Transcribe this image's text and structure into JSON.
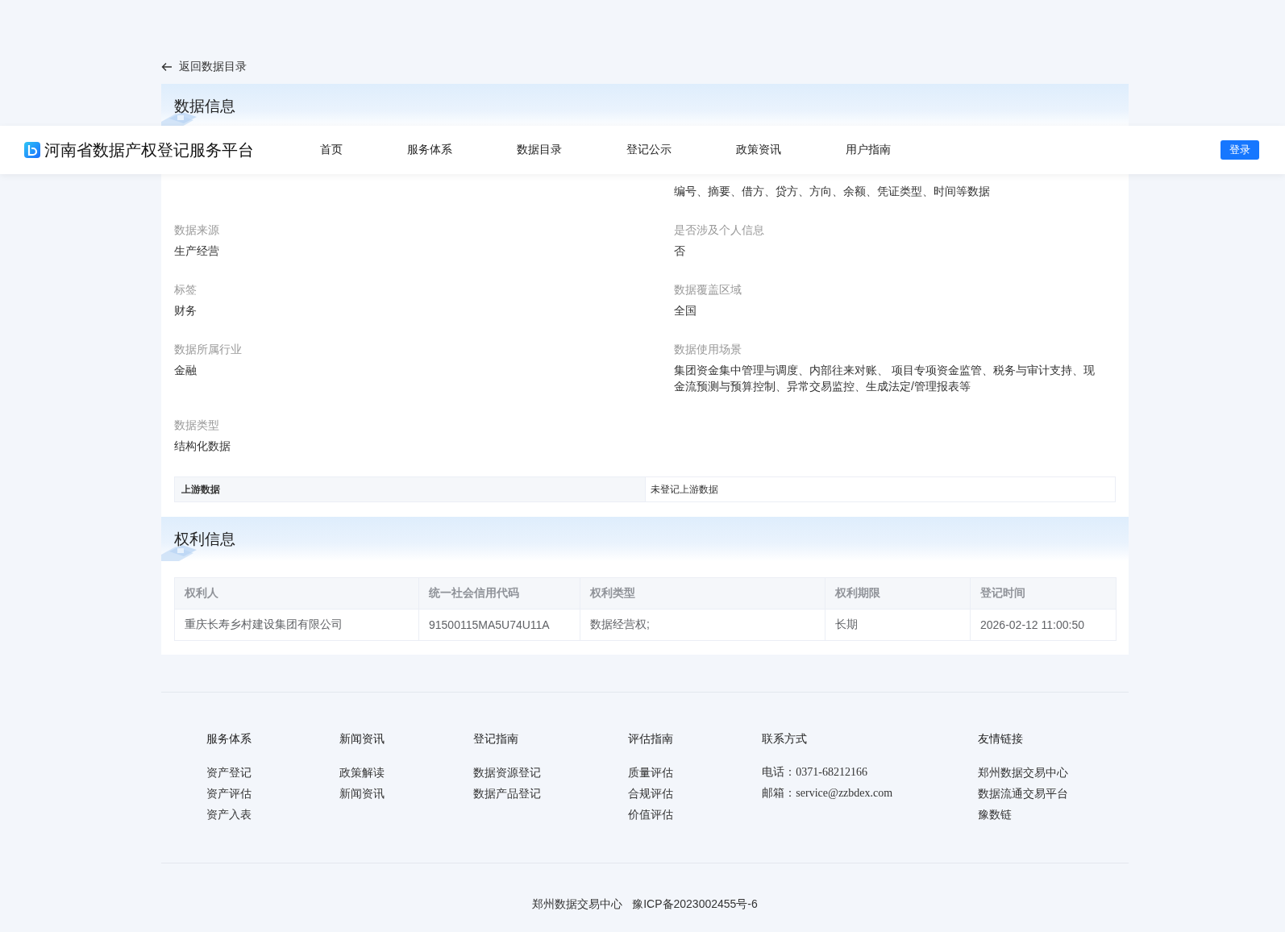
{
  "header": {
    "title": "河南省数据产权登记服务平台",
    "nav": [
      {
        "label": "首页",
        "selected": false
      },
      {
        "label": "服务体系",
        "selected": false
      },
      {
        "label": "数据目录",
        "selected": false
      },
      {
        "label": "登记公示",
        "selected": false
      },
      {
        "label": "政策资讯",
        "selected": false
      },
      {
        "label": "用户指南",
        "selected": false
      }
    ],
    "login": "登录"
  },
  "back": "返回数据目录",
  "data_info": {
    "title": "数据信息",
    "rows": [
      {
        "right": {
          "value": "编号、摘要、借方、贷方、方向、余额、凭证类型、时间等数据"
        }
      },
      {
        "left": {
          "label": "数据来源",
          "value": "生产经营"
        },
        "right": {
          "label": "是否涉及个人信息",
          "value": "否"
        }
      },
      {
        "left": {
          "label": "标签",
          "value": "财务"
        },
        "right": {
          "label": "数据覆盖区域",
          "value": "全国"
        }
      },
      {
        "left": {
          "label": "数据所属行业",
          "value": "金融"
        },
        "right": {
          "label": "数据使用场景",
          "value": "集团资金集中管理与调度、内部往来对账、 项目专项资金监管、税务与审计支持、现金流预测与预算控制、异常交易监控、生成法定/管理报表等"
        }
      },
      {
        "left": {
          "label": "数据类型",
          "value": "结构化数据"
        }
      }
    ],
    "upstream": {
      "label": "上游数据",
      "value": "未登记上游数据"
    }
  },
  "rights_info": {
    "title": "权利信息",
    "columns": [
      "权利人",
      "统一社会信用代码",
      "权利类型",
      "权利期限",
      "登记时间"
    ],
    "rows": [
      [
        "重庆长寿乡村建设集团有限公司",
        "91500115MA5U74U11A",
        "数据经营权;",
        "长期",
        "2026-02-12 11:00:50"
      ]
    ]
  },
  "footer": {
    "columns": [
      {
        "title": "服务体系",
        "kind": "links",
        "items": [
          "资产登记",
          "资产评估",
          "资产入表"
        ]
      },
      {
        "title": "新闻资讯",
        "kind": "links",
        "items": [
          "政策解读",
          "新闻资讯"
        ]
      },
      {
        "title": "登记指南",
        "kind": "links",
        "items": [
          "数据资源登记",
          "数据产品登记"
        ]
      },
      {
        "title": "评估指南",
        "kind": "links",
        "items": [
          "质量评估",
          "合规评估",
          "价值评估"
        ]
      },
      {
        "title": "联系方式",
        "kind": "contact",
        "items": [
          {
            "label": "电话：",
            "value": "0371-68212166"
          },
          {
            "label": "邮箱：",
            "value": "service@zzbdex.com"
          }
        ]
      },
      {
        "title": "友情链接",
        "kind": "links",
        "items": [
          "郑州数据交易中心",
          "数据流通交易平台",
          "豫数链"
        ]
      }
    ],
    "copyright": [
      "郑州数据交易中心",
      "豫ICP备2023002455号-6"
    ]
  }
}
